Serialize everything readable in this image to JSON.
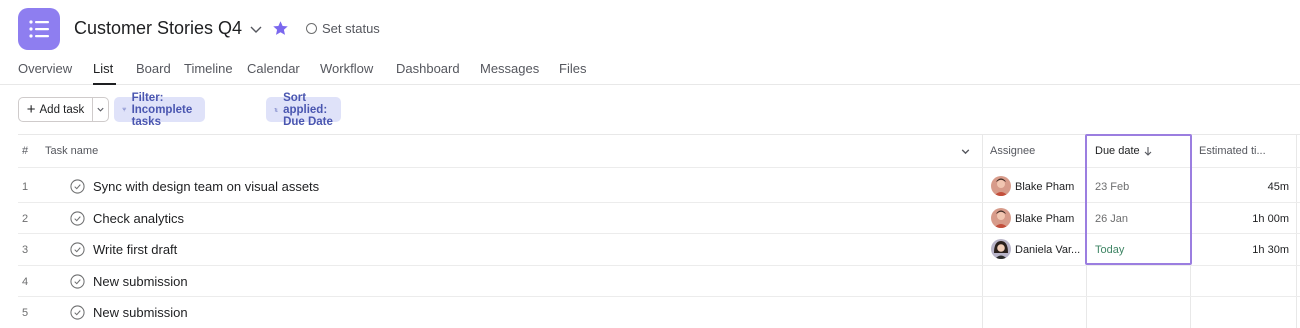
{
  "project": {
    "title": "Customer Stories Q4",
    "icon": "list-icon",
    "accent_color": "#8e7ef0",
    "star_color": "#7b68ee",
    "set_status_label": "Set status"
  },
  "tabs": [
    {
      "label": "Overview"
    },
    {
      "label": "List"
    },
    {
      "label": "Board"
    },
    {
      "label": "Timeline"
    },
    {
      "label": "Calendar"
    },
    {
      "label": "Workflow"
    },
    {
      "label": "Dashboard"
    },
    {
      "label": "Messages"
    },
    {
      "label": "Files"
    }
  ],
  "active_tab": "List",
  "toolbar": {
    "add_task_label": "Add task",
    "filter_label": "Filter: Incomplete tasks",
    "sort_label": "Sort applied: Due Date",
    "chip_color": "#dfe2f9"
  },
  "columns": {
    "number": "#",
    "task_name": "Task name",
    "assignee": "Assignee",
    "due_date": "Due date",
    "estimated_time": "Estimated ti..."
  },
  "tasks": [
    {
      "num": "1",
      "name": "Sync with design team on visual assets",
      "assignee": "Blake Pham",
      "due": "23 Feb",
      "estimate": "45m"
    },
    {
      "num": "2",
      "name": "Check analytics",
      "assignee": "Blake Pham",
      "due": "26 Jan",
      "estimate": "1h 00m"
    },
    {
      "num": "3",
      "name": "Write first draft",
      "assignee": "Daniela Var...",
      "due": "Today",
      "estimate": "1h 30m"
    },
    {
      "num": "4",
      "name": "New submission",
      "assignee": "",
      "due": "",
      "estimate": ""
    },
    {
      "num": "5",
      "name": "New submission",
      "assignee": "",
      "due": "",
      "estimate": ""
    }
  ],
  "highlight_color": "#9b7ee0",
  "today_color": "#3f8565"
}
